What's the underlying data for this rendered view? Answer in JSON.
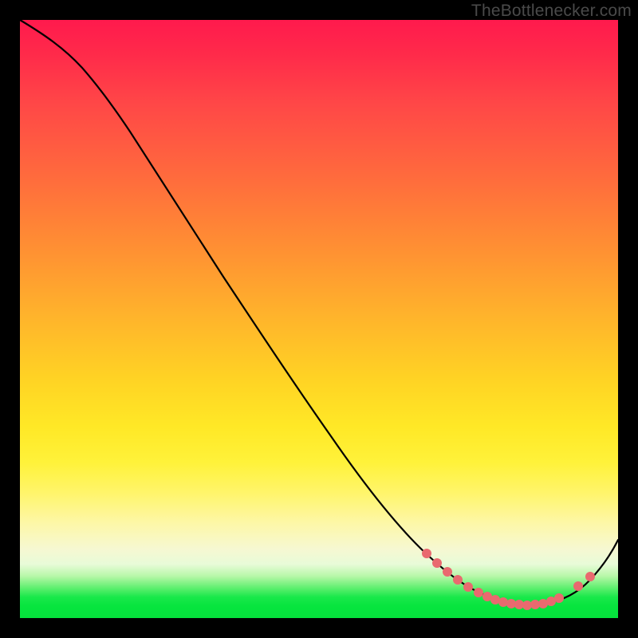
{
  "watermark": "TheBottlenecker.com",
  "chart_data": {
    "type": "line",
    "title": "",
    "xlabel": "",
    "ylabel": "",
    "xlim": [
      0,
      100
    ],
    "ylim": [
      0,
      100
    ],
    "series": [
      {
        "name": "bottleneck-curve",
        "x": [
          0,
          5,
          10,
          15,
          20,
          25,
          30,
          35,
          40,
          45,
          50,
          55,
          60,
          65,
          70,
          75,
          80,
          85,
          90,
          95,
          100
        ],
        "values": [
          100,
          98,
          95,
          90,
          83,
          76,
          69,
          62,
          55,
          48,
          41,
          34,
          27,
          20,
          14,
          9,
          5,
          3,
          3,
          6,
          12
        ]
      }
    ],
    "markers": {
      "name": "highlight-points",
      "x": [
        70,
        72,
        74,
        76,
        78,
        80,
        81,
        82,
        83,
        84,
        85,
        86,
        87,
        88,
        89,
        90,
        93,
        95
      ],
      "values": [
        12,
        10,
        8,
        7,
        6,
        5,
        4.5,
        4,
        4,
        3.5,
        3,
        3,
        3,
        3,
        3.2,
        3.5,
        5,
        6.5
      ]
    },
    "colors": {
      "curve": "#000000",
      "marker": "#e96a6f",
      "gradient_top": "#ff1a4d",
      "gradient_mid": "#ffe826",
      "gradient_bottom": "#05e13c"
    }
  }
}
